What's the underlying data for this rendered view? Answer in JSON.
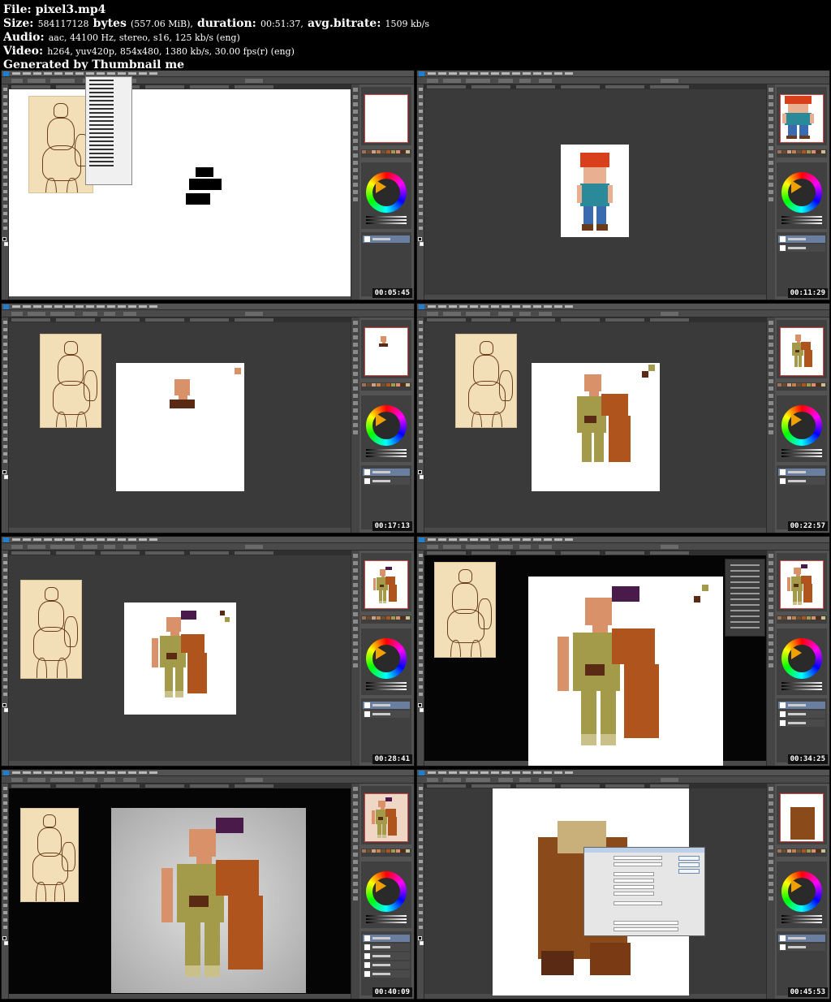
{
  "header": {
    "file_label": "File:",
    "file_value": "pixel3.mp4",
    "size_label": "Size:",
    "size_bytes": "584117128",
    "size_bytes_label": "bytes",
    "size_mib": "(557.06 MiB),",
    "duration_label": "duration:",
    "duration_value": "00:51:37,",
    "bitrate_label": "avg.bitrate:",
    "bitrate_value": "1509 kb/s",
    "audio_label": "Audio:",
    "audio_value": "aac, 44100 Hz, stereo, s16, 125 kb/s (eng)",
    "video_label": "Video:",
    "video_value": "h264, yuv420p, 854x480, 1380 kb/s, 30.00 fps(r) (eng)",
    "generated_by": "Generated by Thumbnail me"
  },
  "thumbnails": [
    {
      "timestamp": "00:05:45"
    },
    {
      "timestamp": "00:11:29"
    },
    {
      "timestamp": "00:17:13"
    },
    {
      "timestamp": "00:22:57"
    },
    {
      "timestamp": "00:28:41"
    },
    {
      "timestamp": "00:34:25"
    },
    {
      "timestamp": "00:40:09"
    },
    {
      "timestamp": "00:45:53"
    }
  ],
  "colors": {
    "ps_background": "#3a3a3a",
    "ps_panel": "#535353",
    "skin": "#d9916a",
    "olive": "#a39a4a",
    "rust_brown": "#b0541e",
    "dark_brown": "#5a2a14",
    "purple": "#4a1a4a",
    "khaki": "#c9c08a"
  },
  "icons": [
    "photoshop-logo-icon",
    "color-wheel-icon",
    "layer-thumbnail-icon"
  ]
}
